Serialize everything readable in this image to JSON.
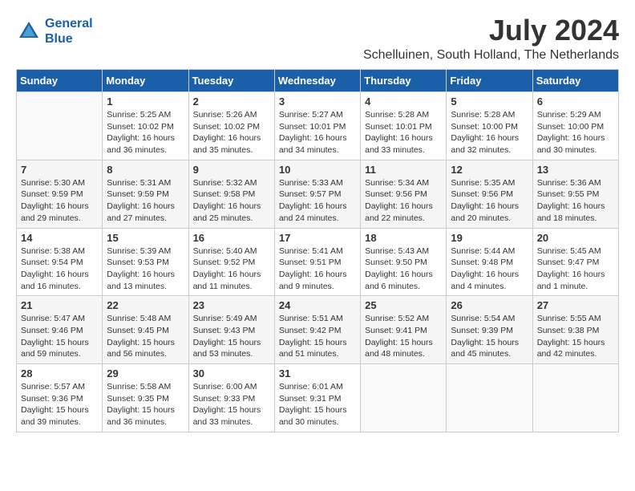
{
  "header": {
    "logo_line1": "General",
    "logo_line2": "Blue",
    "month": "July 2024",
    "location": "Schelluinen, South Holland, The Netherlands"
  },
  "days_of_week": [
    "Sunday",
    "Monday",
    "Tuesday",
    "Wednesday",
    "Thursday",
    "Friday",
    "Saturday"
  ],
  "weeks": [
    [
      {
        "day": "",
        "info": ""
      },
      {
        "day": "1",
        "info": "Sunrise: 5:25 AM\nSunset: 10:02 PM\nDaylight: 16 hours\nand 36 minutes."
      },
      {
        "day": "2",
        "info": "Sunrise: 5:26 AM\nSunset: 10:02 PM\nDaylight: 16 hours\nand 35 minutes."
      },
      {
        "day": "3",
        "info": "Sunrise: 5:27 AM\nSunset: 10:01 PM\nDaylight: 16 hours\nand 34 minutes."
      },
      {
        "day": "4",
        "info": "Sunrise: 5:28 AM\nSunset: 10:01 PM\nDaylight: 16 hours\nand 33 minutes."
      },
      {
        "day": "5",
        "info": "Sunrise: 5:28 AM\nSunset: 10:00 PM\nDaylight: 16 hours\nand 32 minutes."
      },
      {
        "day": "6",
        "info": "Sunrise: 5:29 AM\nSunset: 10:00 PM\nDaylight: 16 hours\nand 30 minutes."
      }
    ],
    [
      {
        "day": "7",
        "info": "Sunrise: 5:30 AM\nSunset: 9:59 PM\nDaylight: 16 hours\nand 29 minutes."
      },
      {
        "day": "8",
        "info": "Sunrise: 5:31 AM\nSunset: 9:59 PM\nDaylight: 16 hours\nand 27 minutes."
      },
      {
        "day": "9",
        "info": "Sunrise: 5:32 AM\nSunset: 9:58 PM\nDaylight: 16 hours\nand 25 minutes."
      },
      {
        "day": "10",
        "info": "Sunrise: 5:33 AM\nSunset: 9:57 PM\nDaylight: 16 hours\nand 24 minutes."
      },
      {
        "day": "11",
        "info": "Sunrise: 5:34 AM\nSunset: 9:56 PM\nDaylight: 16 hours\nand 22 minutes."
      },
      {
        "day": "12",
        "info": "Sunrise: 5:35 AM\nSunset: 9:56 PM\nDaylight: 16 hours\nand 20 minutes."
      },
      {
        "day": "13",
        "info": "Sunrise: 5:36 AM\nSunset: 9:55 PM\nDaylight: 16 hours\nand 18 minutes."
      }
    ],
    [
      {
        "day": "14",
        "info": "Sunrise: 5:38 AM\nSunset: 9:54 PM\nDaylight: 16 hours\nand 16 minutes."
      },
      {
        "day": "15",
        "info": "Sunrise: 5:39 AM\nSunset: 9:53 PM\nDaylight: 16 hours\nand 13 minutes."
      },
      {
        "day": "16",
        "info": "Sunrise: 5:40 AM\nSunset: 9:52 PM\nDaylight: 16 hours\nand 11 minutes."
      },
      {
        "day": "17",
        "info": "Sunrise: 5:41 AM\nSunset: 9:51 PM\nDaylight: 16 hours\nand 9 minutes."
      },
      {
        "day": "18",
        "info": "Sunrise: 5:43 AM\nSunset: 9:50 PM\nDaylight: 16 hours\nand 6 minutes."
      },
      {
        "day": "19",
        "info": "Sunrise: 5:44 AM\nSunset: 9:48 PM\nDaylight: 16 hours\nand 4 minutes."
      },
      {
        "day": "20",
        "info": "Sunrise: 5:45 AM\nSunset: 9:47 PM\nDaylight: 16 hours\nand 1 minute."
      }
    ],
    [
      {
        "day": "21",
        "info": "Sunrise: 5:47 AM\nSunset: 9:46 PM\nDaylight: 15 hours\nand 59 minutes."
      },
      {
        "day": "22",
        "info": "Sunrise: 5:48 AM\nSunset: 9:45 PM\nDaylight: 15 hours\nand 56 minutes."
      },
      {
        "day": "23",
        "info": "Sunrise: 5:49 AM\nSunset: 9:43 PM\nDaylight: 15 hours\nand 53 minutes."
      },
      {
        "day": "24",
        "info": "Sunrise: 5:51 AM\nSunset: 9:42 PM\nDaylight: 15 hours\nand 51 minutes."
      },
      {
        "day": "25",
        "info": "Sunrise: 5:52 AM\nSunset: 9:41 PM\nDaylight: 15 hours\nand 48 minutes."
      },
      {
        "day": "26",
        "info": "Sunrise: 5:54 AM\nSunset: 9:39 PM\nDaylight: 15 hours\nand 45 minutes."
      },
      {
        "day": "27",
        "info": "Sunrise: 5:55 AM\nSunset: 9:38 PM\nDaylight: 15 hours\nand 42 minutes."
      }
    ],
    [
      {
        "day": "28",
        "info": "Sunrise: 5:57 AM\nSunset: 9:36 PM\nDaylight: 15 hours\nand 39 minutes."
      },
      {
        "day": "29",
        "info": "Sunrise: 5:58 AM\nSunset: 9:35 PM\nDaylight: 15 hours\nand 36 minutes."
      },
      {
        "day": "30",
        "info": "Sunrise: 6:00 AM\nSunset: 9:33 PM\nDaylight: 15 hours\nand 33 minutes."
      },
      {
        "day": "31",
        "info": "Sunrise: 6:01 AM\nSunset: 9:31 PM\nDaylight: 15 hours\nand 30 minutes."
      },
      {
        "day": "",
        "info": ""
      },
      {
        "day": "",
        "info": ""
      },
      {
        "day": "",
        "info": ""
      }
    ]
  ]
}
